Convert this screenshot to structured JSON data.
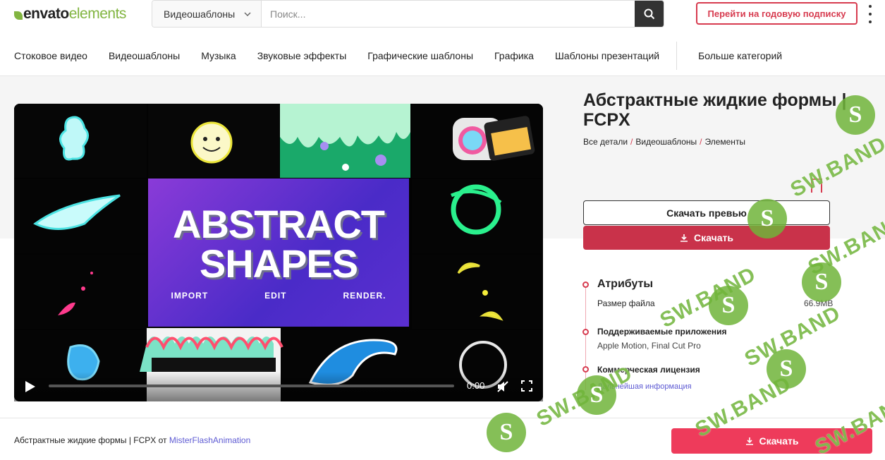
{
  "header": {
    "logo_part1": "envato",
    "logo_part2": "elements",
    "search_category": "Видеошаблоны",
    "search_placeholder": "Поиск...",
    "subscribe_label": "Перейти на годовую подписку"
  },
  "nav": {
    "items": [
      "Стоковое видео",
      "Видеошаблоны",
      "Музыка",
      "Звуковые эффекты",
      "Графические шаблоны",
      "Графика",
      "Шаблоны презентаций"
    ],
    "more_label": "Больше категорий"
  },
  "player": {
    "title_line1": "ABSTRACT",
    "title_line2": "SHAPES",
    "sub1": "IMPORT",
    "sub2": "EDIT",
    "sub3": "RENDER.",
    "time": "0:00",
    "progress": 0
  },
  "item": {
    "title": "Абстрактные жидкие формы | FCPX",
    "breadcrumb": [
      "Все детали",
      "Видеошаблоны",
      "Элементы"
    ],
    "preview_label": "Скачать превью",
    "download_label": "Скачать"
  },
  "attributes": {
    "heading": "Атрибуты",
    "filesize_label": "Размер файла",
    "filesize_value": "66.9MB",
    "apps_label": "Поддерживаемые приложения",
    "apps_value": "Apple Motion, Final Cut Pro",
    "license_label": "Коммерческая лицензия",
    "license_link": "Дальнейшая информация"
  },
  "footer": {
    "text": "Абстрактные жидкие формы | FCPX от",
    "author": "MisterFlashAnimation",
    "download_label": "Скачать"
  },
  "watermark": {
    "text": "SW.BAND",
    "glyph": "S",
    "color": "#70b43a"
  },
  "colors": {
    "accent": "#d73b4f",
    "brand_green": "#82b541",
    "download_bg": "#c9324a",
    "footer_download_bg": "#ee3b5b",
    "link": "#5e5bd3"
  }
}
